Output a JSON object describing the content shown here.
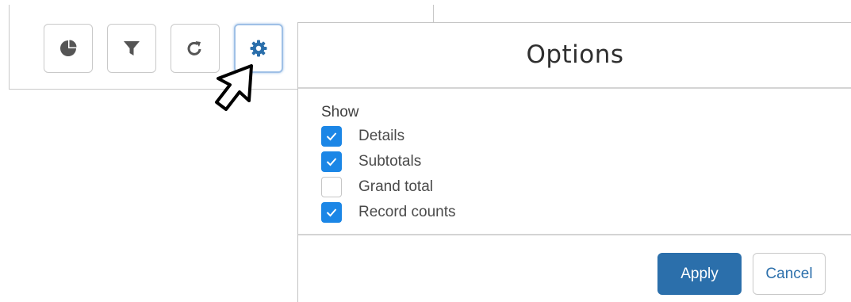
{
  "toolbar": {
    "buttons": [
      {
        "icon": "pie-chart-icon"
      },
      {
        "icon": "filter-icon"
      },
      {
        "icon": "refresh-icon"
      },
      {
        "icon": "gear-icon",
        "active": true
      }
    ]
  },
  "options_panel": {
    "title": "Options",
    "show_label": "Show",
    "items": [
      {
        "label": "Details",
        "checked": true
      },
      {
        "label": "Subtotals",
        "checked": true
      },
      {
        "label": "Grand total",
        "checked": false
      },
      {
        "label": "Record counts",
        "checked": true
      }
    ],
    "apply_label": "Apply",
    "cancel_label": "Cancel"
  },
  "colors": {
    "checkbox_on": "#1b86e6",
    "apply_bg": "#2b6fab",
    "link_text": "#2b6fab",
    "icon": "#555555",
    "gear_icon": "#2b6fab"
  }
}
